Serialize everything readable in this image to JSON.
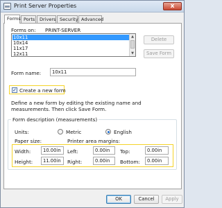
{
  "window": {
    "title": "Print Server Properties",
    "close_glyph": "x"
  },
  "tabs": [
    "Forms",
    "Ports",
    "Drivers",
    "Security",
    "Advanced"
  ],
  "forms_on": {
    "label": "Forms on:",
    "server": "PRINT-SERVER"
  },
  "forms_list": {
    "items": [
      "10x11",
      "10x14",
      "11x17",
      "12x11"
    ],
    "selected": "10x11"
  },
  "buttons": {
    "delete": "Delete",
    "save_form": "Save Form",
    "ok": "OK",
    "cancel": "Cancel",
    "apply": "Apply"
  },
  "form_name": {
    "label": "Form name:",
    "value": "10x11"
  },
  "create_new_form": {
    "label": "Create a new form",
    "checked": true
  },
  "description_text": {
    "line1": "Define a new form by editing the existing name and",
    "line2": "measurements. Then click Save Form."
  },
  "form_description": {
    "title": "Form description (measurements)",
    "units_label": "Units:",
    "metric_label": "Metric",
    "english_label": "English",
    "selected_unit": "English",
    "paper_size_label": "Paper size:",
    "margins_label": "Printer area margins:",
    "width_label": "Width:",
    "width_value": "10.00in",
    "height_label": "Height:",
    "height_value": "11.00in",
    "left_label": "Left:",
    "left_value": "0.00in",
    "right_label": "Right:",
    "right_value": "0.00in",
    "top_label": "Top:",
    "top_value": "0.00in",
    "bottom_label": "Bottom:",
    "bottom_value": "0.00in"
  },
  "colors": {
    "highlight": "#f5d328",
    "selection": "#3399ff",
    "close": "#c94a33"
  }
}
